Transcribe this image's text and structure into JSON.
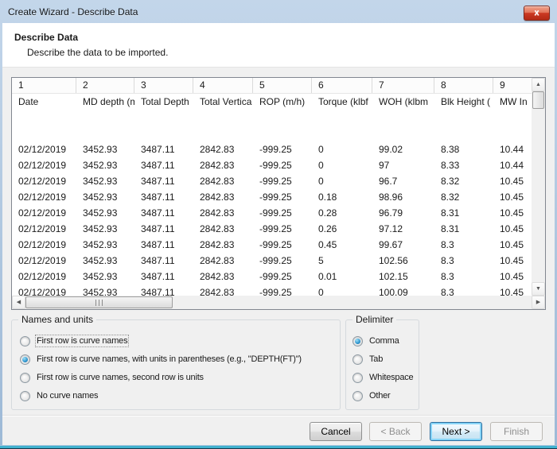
{
  "window": {
    "title": "Create Wizard - Describe Data",
    "close_glyph": "x"
  },
  "banner": {
    "title": "Describe Data",
    "subtitle": "Describe the data to be imported."
  },
  "table": {
    "column_numbers": [
      "1",
      "2",
      "3",
      "4",
      "5",
      "6",
      "7",
      "8",
      "9"
    ],
    "column_names": [
      "Date",
      "MD depth (m",
      "Total Depth",
      "Total Vertica",
      "ROP (m/h)",
      "Torque (klbf",
      "WOH (klbm",
      "Blk Height (",
      "MW In"
    ],
    "empty_rows_after_header": 2,
    "rows": [
      [
        "02/12/2019",
        "3452.93",
        "3487.11",
        "2842.83",
        "-999.25",
        "0",
        "99.02",
        "8.38",
        "10.44"
      ],
      [
        "02/12/2019",
        "3452.93",
        "3487.11",
        "2842.83",
        "-999.25",
        "0",
        "97",
        "8.33",
        "10.44"
      ],
      [
        "02/12/2019",
        "3452.93",
        "3487.11",
        "2842.83",
        "-999.25",
        "0",
        "96.7",
        "8.32",
        "10.45"
      ],
      [
        "02/12/2019",
        "3452.93",
        "3487.11",
        "2842.83",
        "-999.25",
        "0.18",
        "98.96",
        "8.32",
        "10.45"
      ],
      [
        "02/12/2019",
        "3452.93",
        "3487.11",
        "2842.83",
        "-999.25",
        "0.28",
        "96.79",
        "8.31",
        "10.45"
      ],
      [
        "02/12/2019",
        "3452.93",
        "3487.11",
        "2842.83",
        "-999.25",
        "0.26",
        "97.12",
        "8.31",
        "10.45"
      ],
      [
        "02/12/2019",
        "3452.93",
        "3487.11",
        "2842.83",
        "-999.25",
        "0.45",
        "99.67",
        "8.3",
        "10.45"
      ],
      [
        "02/12/2019",
        "3452.93",
        "3487.11",
        "2842.83",
        "-999.25",
        "5",
        "102.56",
        "8.3",
        "10.45"
      ],
      [
        "02/12/2019",
        "3452.93",
        "3487.11",
        "2842.83",
        "-999.25",
        "0.01",
        "102.15",
        "8.3",
        "10.45"
      ],
      [
        "02/12/2019",
        "3452.93",
        "3487.11",
        "2842.83",
        "-999.25",
        "0",
        "100.09",
        "8.3",
        "10.45"
      ]
    ]
  },
  "names_units": {
    "title": "Names and units",
    "options": [
      {
        "label": "First row is curve names",
        "selected": false
      },
      {
        "label": "First row is curve names, with units in parentheses (e.g., \"DEPTH(FT)\")",
        "selected": true
      },
      {
        "label": "First row is curve names, second row is units",
        "selected": false
      },
      {
        "label": "No curve names",
        "selected": false
      }
    ]
  },
  "delimiter": {
    "title": "Delimiter",
    "options": [
      {
        "label": "Comma",
        "selected": true
      },
      {
        "label": "Tab",
        "selected": false
      },
      {
        "label": "Whitespace",
        "selected": false
      },
      {
        "label": "Other",
        "selected": false
      }
    ]
  },
  "buttons": {
    "cancel": {
      "label": "Cancel",
      "enabled": true
    },
    "back": {
      "label": "< Back",
      "enabled": false
    },
    "next": {
      "label": "Next >",
      "enabled": true,
      "default": true
    },
    "finish": {
      "label": "Finish",
      "enabled": false
    }
  },
  "colors": {
    "titlebar_top": "#c3d6ea",
    "titlebar_bottom": "#9db9d6",
    "close_red": "#cc3a24",
    "bottom_band_teal": "#41b1cf",
    "radio_selected_blue": "#2f96cf",
    "default_button_glow": "#86d4f7",
    "dialog_bg": "#f0f0f0",
    "grid_border": "#828790"
  }
}
